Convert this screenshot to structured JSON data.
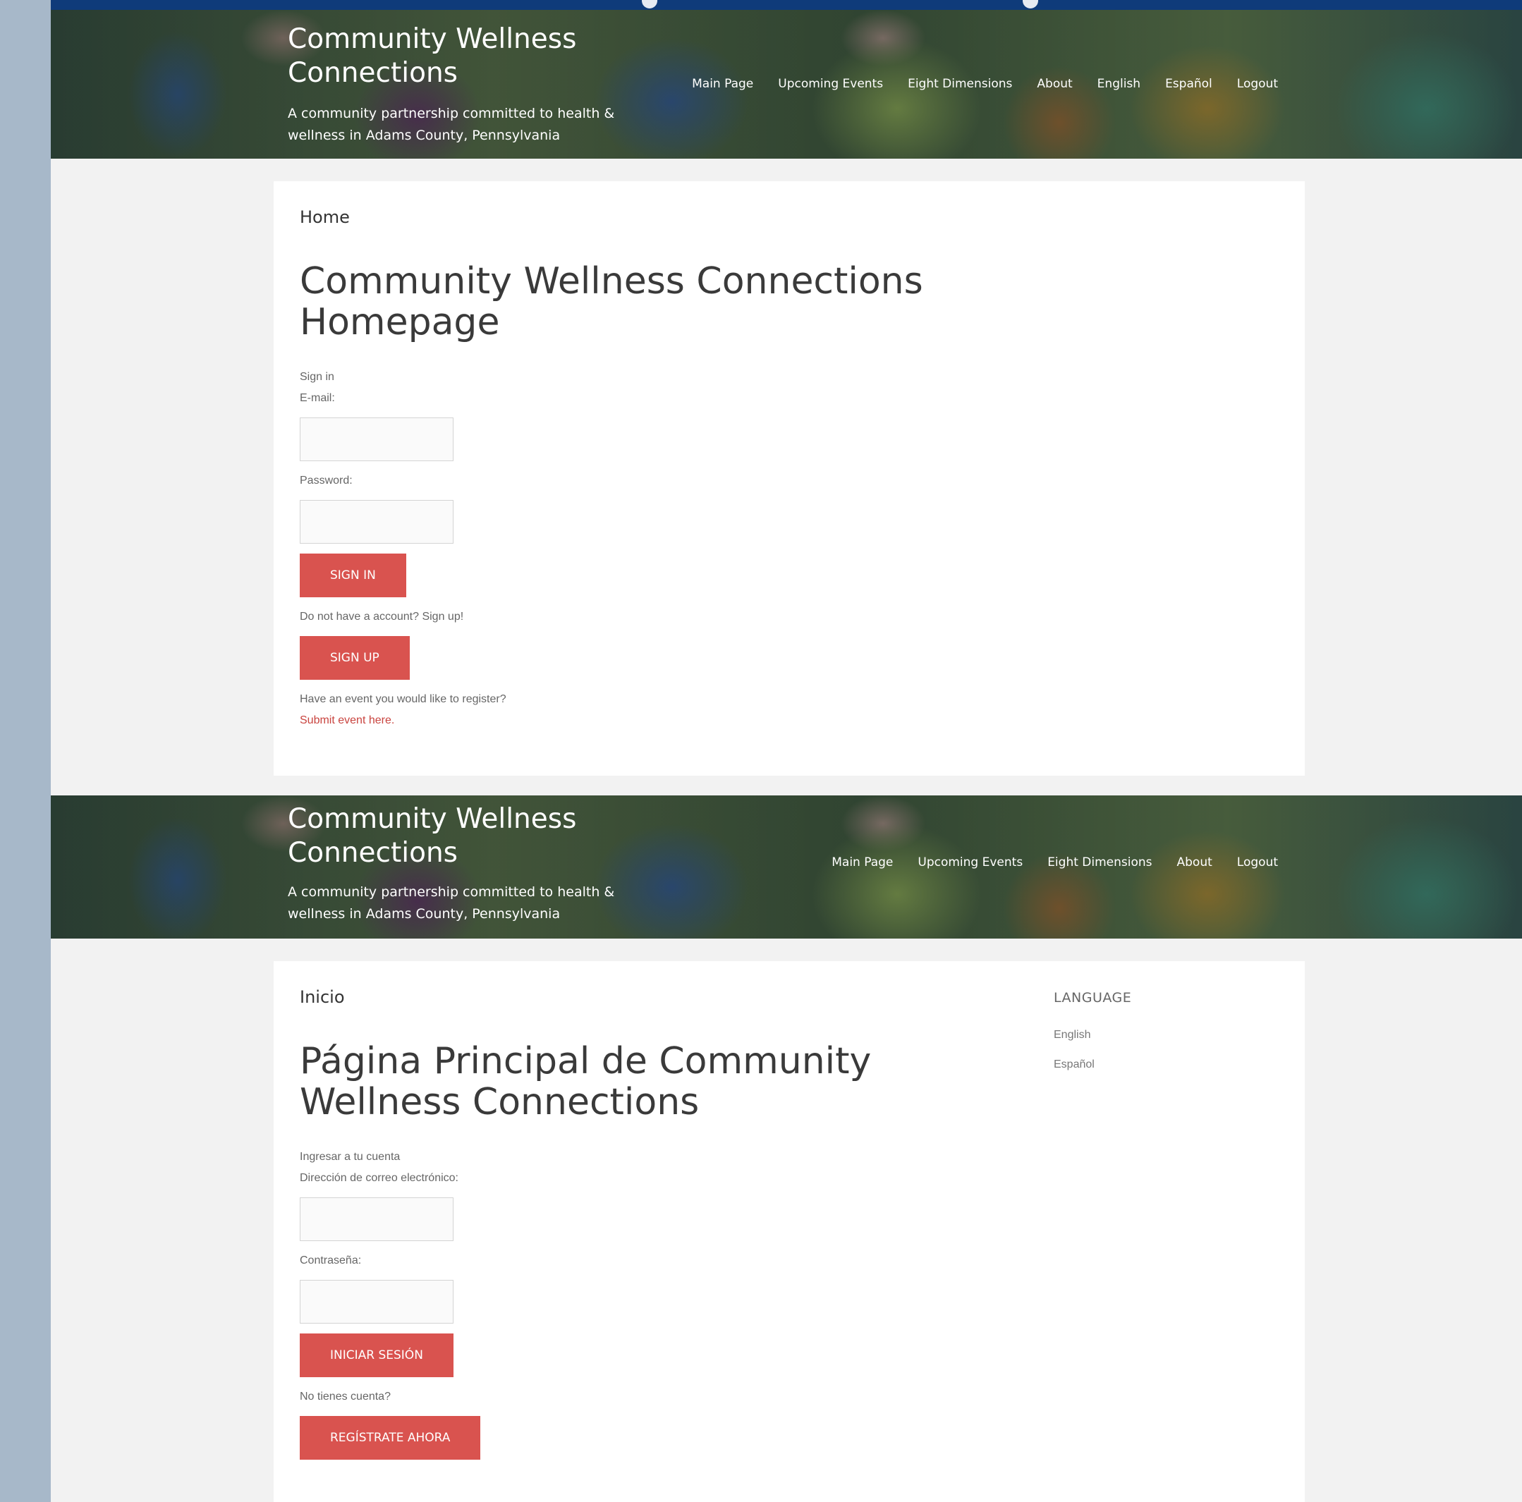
{
  "site": {
    "title": "Community Wellness Connections",
    "tagline": "A community partnership committed to health & wellness in Adams County, Pennsylvania"
  },
  "colors": {
    "accent_button": "#d9534f",
    "link": "#c9443f",
    "top_bar": "#0f3b7a",
    "side_strip": "#a7b8c9",
    "page_bg": "#f2f2f2"
  },
  "english_view": {
    "nav": [
      "Main Page",
      "Upcoming Events",
      "Eight Dimensions",
      "About",
      "English",
      "Español",
      "Logout"
    ],
    "breadcrumb": "Home",
    "page_title": "Community Wellness Connections Homepage",
    "sign_in_heading": "Sign in",
    "email_label": "E-mail:",
    "email_value": "",
    "password_label": "Password:",
    "password_value": "",
    "sign_in_button": "Sign In",
    "no_account_text": "Do not have a account? Sign up!",
    "sign_up_button": "Sign Up",
    "event_prompt": "Have an event you would like to register?",
    "event_link": "Submit event here."
  },
  "spanish_view": {
    "nav": [
      "Main Page",
      "Upcoming Events",
      "Eight Dimensions",
      "About",
      "Logout"
    ],
    "breadcrumb": "Inicio",
    "page_title": "Página Principal de Community Wellness Connections",
    "sign_in_heading": "Ingresar a tu cuenta",
    "email_label": "Dirección de correo electrónico:",
    "email_value": "",
    "password_label": "Contraseña:",
    "password_value": "",
    "sign_in_button": "Iniciar Sesión",
    "no_account_text": "No tienes cuenta?",
    "sign_up_button": "Regístrate Ahora",
    "sidebar": {
      "title": "Language",
      "links": [
        "English",
        "Español"
      ]
    }
  }
}
